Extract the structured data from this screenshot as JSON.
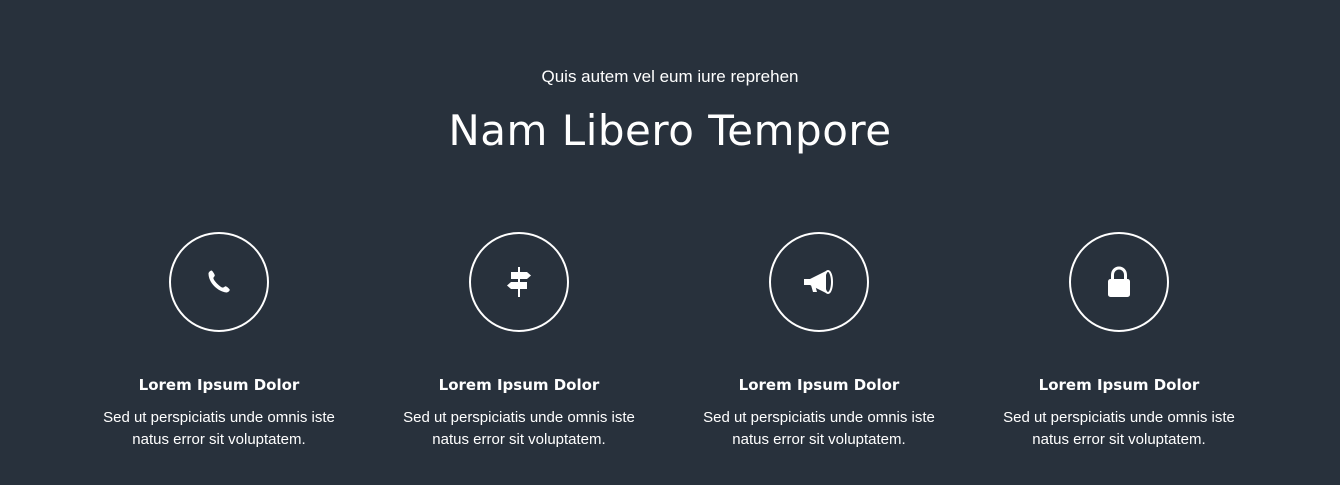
{
  "header": {
    "subtitle": "Quis autem vel eum iure reprehen",
    "title": "Nam Libero Tempore"
  },
  "features": [
    {
      "icon": "phone-icon",
      "heading": "Lorem Ipsum Dolor",
      "text": "Sed ut perspiciatis unde omnis iste natus error sit voluptatem."
    },
    {
      "icon": "signpost-icon",
      "heading": "Lorem Ipsum Dolor",
      "text": "Sed ut perspiciatis unde omnis iste natus error sit voluptatem."
    },
    {
      "icon": "megaphone-icon",
      "heading": "Lorem Ipsum Dolor",
      "text": "Sed ut perspiciatis unde omnis iste natus error sit voluptatem."
    },
    {
      "icon": "lock-icon",
      "heading": "Lorem Ipsum Dolor",
      "text": "Sed ut perspiciatis unde omnis iste natus error sit voluptatem."
    }
  ],
  "colors": {
    "background": "#28313c",
    "foreground": "#ffffff"
  }
}
